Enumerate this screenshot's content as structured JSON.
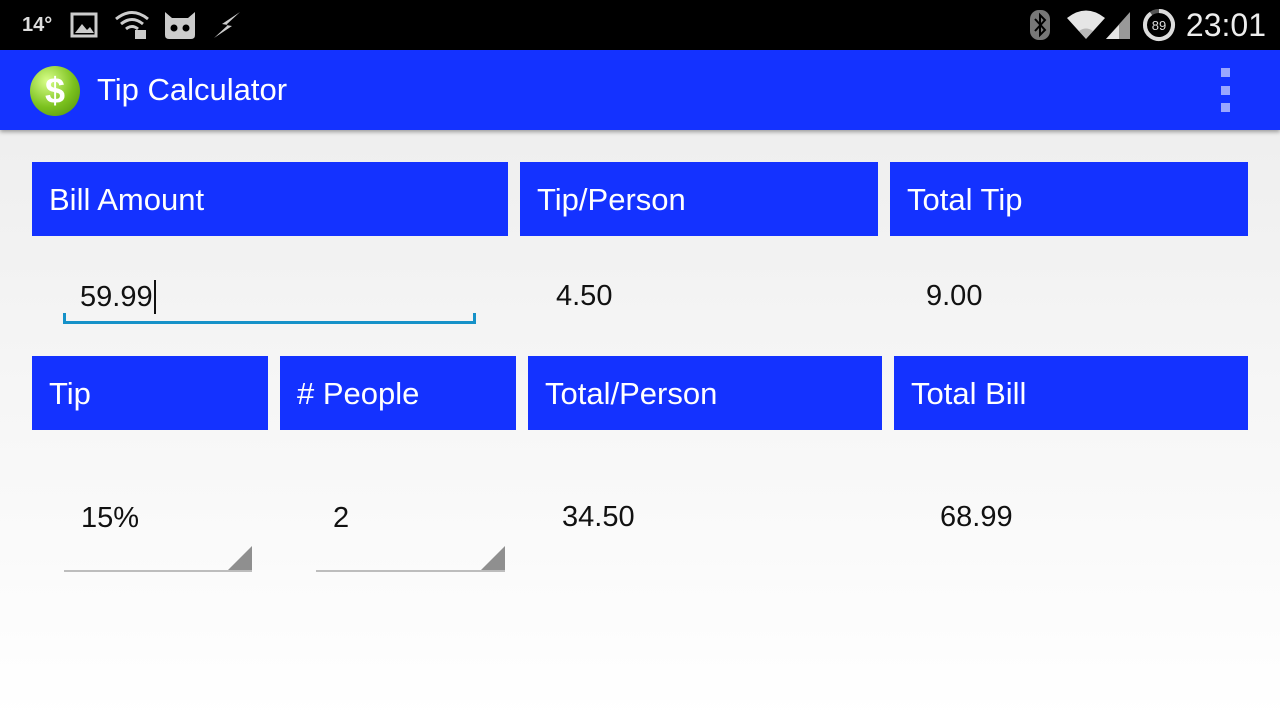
{
  "status_bar": {
    "temperature": "14°",
    "battery_level": "89",
    "clock": "23:01",
    "icons": [
      "image-icon",
      "wifi-lock-icon",
      "cyanogen-icon",
      "flash-icon",
      "bluetooth-icon",
      "wifi-icon",
      "cell-signal-icon",
      "battery-icon"
    ]
  },
  "app_bar": {
    "title": "Tip Calculator",
    "icon": "dollar-coin-icon",
    "overflow_icon": "more-vert-icon",
    "color": "#1432ff"
  },
  "headers": {
    "bill_amount": "Bill Amount",
    "tip_per_person": "Tip/Person",
    "total_tip": "Total Tip",
    "tip": "Tip",
    "people": "# People",
    "total_per_person": "Total/Person",
    "total_bill": "Total Bill"
  },
  "values": {
    "bill_amount": "59.99",
    "tip_per_person": "4.50",
    "total_tip": "9.00",
    "tip_percent": "15%",
    "people": "2",
    "total_per_person": "34.50",
    "total_bill": "68.99"
  },
  "colors": {
    "accent": "#1432ff",
    "input_underline": "#1591c8"
  }
}
